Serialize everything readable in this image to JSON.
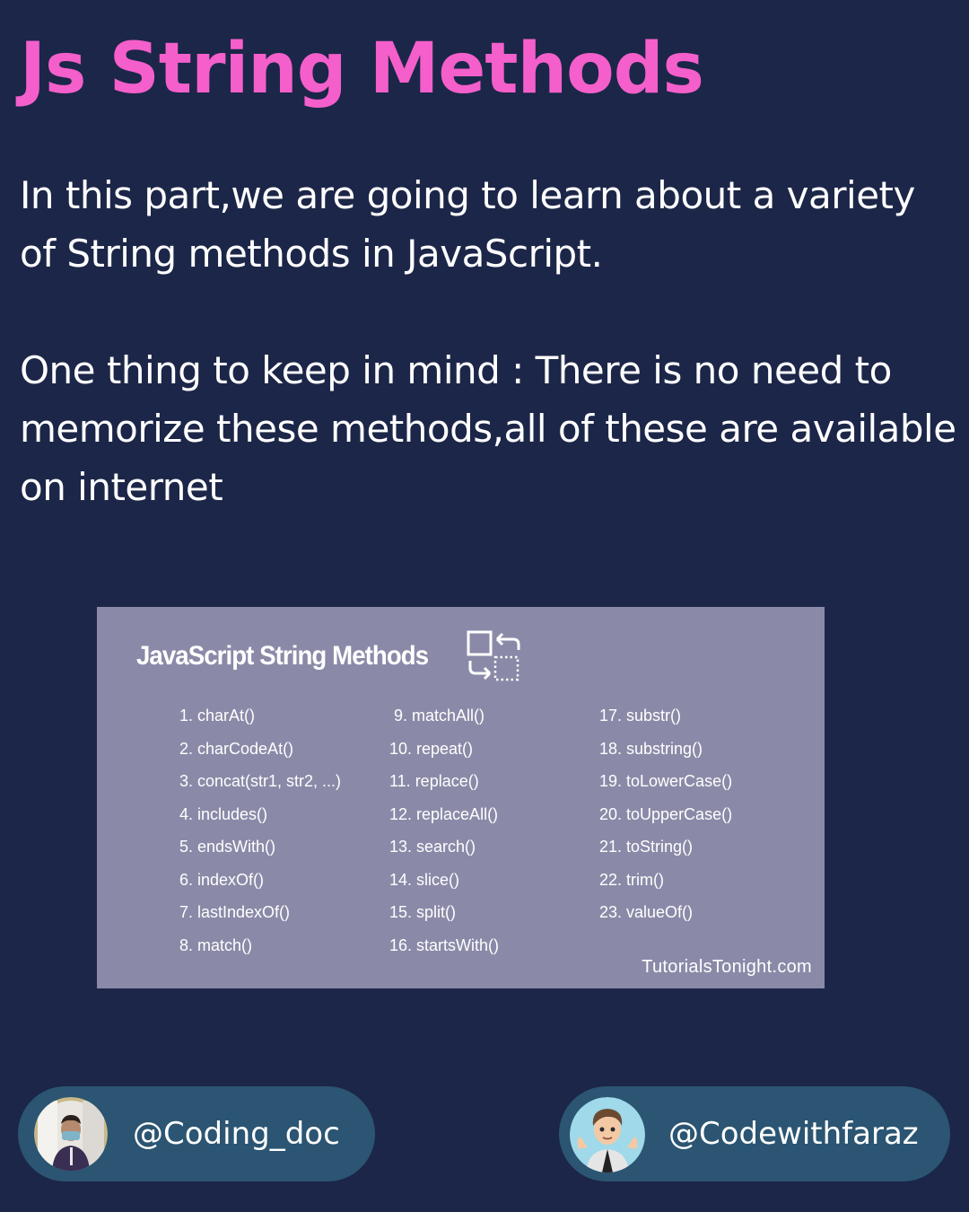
{
  "title": "Js String Methods",
  "paragraphs": {
    "intro": "In this part,we are going to learn about a variety of String methods in JavaScript.",
    "note": "One thing to keep in mind : There is no need to memorize these methods,all of these are available on internet"
  },
  "card": {
    "title": "JavaScript String Methods",
    "icon": "swap-icon",
    "columns": [
      [
        "1. charAt()",
        "2. charCodeAt()",
        "3. concat(str1, str2, ...)",
        "4. includes()",
        "5. endsWith()",
        "6. indexOf()",
        "7. lastIndexOf()",
        "8. match()"
      ],
      [
        " 9. matchAll()",
        "10. repeat()",
        "11. replace()",
        "12. replaceAll()",
        "13. search()",
        "14. slice()",
        "15. split()",
        "16. startsWith()"
      ],
      [
        "17. substr()",
        "18. substring()",
        "19. toLowerCase()",
        "20. toUpperCase()",
        "21. toString()",
        "22. trim()",
        "23. valueOf()"
      ]
    ],
    "credit": "TutorialsTonight.com"
  },
  "footer": {
    "left": {
      "handle": "@Coding_doc",
      "avatar": "profile-photo"
    },
    "right": {
      "handle": "@Codewithfaraz",
      "avatar": "cartoon-avatar"
    }
  },
  "colors": {
    "background": "#1c2648",
    "title": "#f45fcb",
    "card": "#8a8aa8",
    "pill": "#2b5572"
  }
}
